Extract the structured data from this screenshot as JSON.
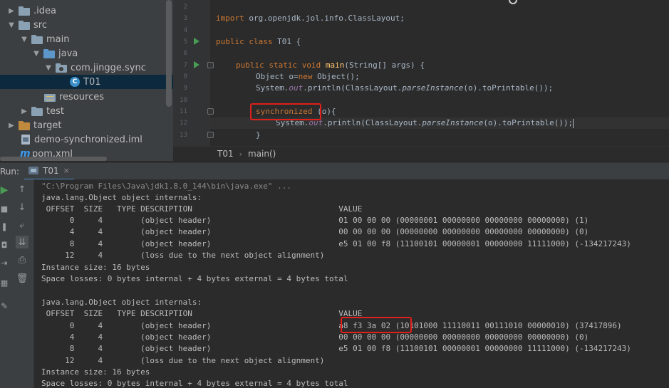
{
  "project_tree": [
    {
      "label": ".idea",
      "arrow": "▶",
      "icon": "folder-gray",
      "depth": 0
    },
    {
      "label": "src",
      "arrow": "▼",
      "icon": "folder-gray",
      "depth": 0
    },
    {
      "label": "main",
      "arrow": "▼",
      "icon": "folder-gray",
      "depth": 1
    },
    {
      "label": "java",
      "arrow": "▼",
      "icon": "folder-blue",
      "depth": 2
    },
    {
      "label": "com.jingge.sync",
      "arrow": "▼",
      "icon": "package",
      "depth": 3
    },
    {
      "label": "T01",
      "arrow": "",
      "icon": "class",
      "depth": 4,
      "selected": true
    },
    {
      "label": "resources",
      "arrow": "",
      "icon": "folder-resources",
      "depth": 3
    },
    {
      "label": "test",
      "arrow": "▶",
      "icon": "folder-gray",
      "depth": 1
    },
    {
      "label": "target",
      "arrow": "▶",
      "icon": "folder-orange",
      "depth": 0
    },
    {
      "label": "demo-synchronized.iml",
      "arrow": "",
      "icon": "iml",
      "depth": 1
    },
    {
      "label": "pom.xml",
      "arrow": "",
      "icon": "maven",
      "depth": 1
    }
  ],
  "editor": {
    "line_numbers": [
      "2",
      "3",
      "4",
      "5",
      "6",
      "7",
      "8",
      "9",
      "10",
      "11",
      "12",
      "13"
    ],
    "code": {
      "import_kw": "import",
      "import_path": " org.openjdk.jol.info.ClassLayout;",
      "class_decl_kw": "public class",
      "class_name": " T01 {",
      "main_kw": "public static void",
      "main_name": "main",
      "main_args": "(String[] args) {",
      "obj_type": "Object o=",
      "new_kw": "new",
      "obj_ctor": " Object();",
      "print1_a": "System.",
      "print1_out": "out",
      "print1_b": ".println(ClassLayout.",
      "print1_parse": "parseInstance",
      "print1_c": "(o).toPrintable());",
      "sync_kw": "synchronized",
      "sync_rest": " (o){",
      "print2_a": "System.",
      "print2_out": "out",
      "print2_b": ".println(ClassLayout.",
      "print2_parse": "parseInstance",
      "print2_c": "(o).toPrintable());",
      "close_brace": "}"
    },
    "breadcrumbs": [
      "T01",
      "main()"
    ],
    "breadcrumb_sep": "›"
  },
  "run": {
    "label": "Run:",
    "tab_name": "T01",
    "tab_close": "×"
  },
  "console": {
    "command": "\"C:\\Program Files\\Java\\jdk1.8.0_144\\bin\\java.exe\" ...",
    "blocks": [
      {
        "title": "java.lang.Object object internals:",
        "header": " OFFSET  SIZE   TYPE DESCRIPTION                               VALUE",
        "rows": [
          "      0     4        (object header)                           01 00 00 00 (00000001 00000000 00000000 00000000) (1)",
          "      4     4        (object header)                           00 00 00 00 (00000000 00000000 00000000 00000000) (0)",
          "      8     4        (object header)                           e5 01 00 f8 (11100101 00000001 00000000 11111000) (-134217243)",
          "     12     4        (loss due to the next object alignment)"
        ],
        "instance_size": "Instance size: 16 bytes",
        "space_losses": "Space losses: 0 bytes internal + 4 bytes external = 4 bytes total"
      },
      {
        "title": "java.lang.Object object internals:",
        "header": " OFFSET  SIZE   TYPE DESCRIPTION                               VALUE",
        "rows": [
          "      0     4        (object header)                           a8 f3 3a 02 (10101000 11110011 00111010 00000010) (37417896)",
          "      4     4        (object header)                           00 00 00 00 (00000000 00000000 00000000 00000000) (0)",
          "      8     4        (object header)                           e5 01 00 f8 (11100101 00000001 00000000 11111000) (-134217243)",
          "     12     4        (loss due to the next object alignment)"
        ],
        "instance_size": "Instance size: 16 bytes",
        "space_losses": "Space losses: 0 bytes internal + 4 bytes external = 4 bytes total"
      }
    ]
  },
  "colors": {
    "keyword": "#cc7832",
    "method": "#ffc66d",
    "field": "#9876aa",
    "text": "#a9b7c6",
    "highlight_box": "#e0201b",
    "selection": "#0d293e"
  }
}
